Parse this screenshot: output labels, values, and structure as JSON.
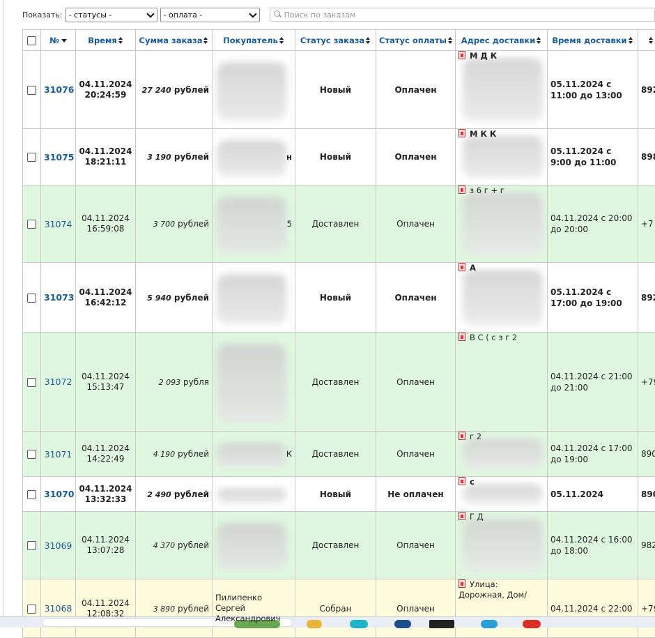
{
  "filters": {
    "show_label": "Показать:",
    "status_select": "- статусы -",
    "payment_select": "- оплата -",
    "search_placeholder": "Поиск по заказам"
  },
  "columns": [
    {
      "key": "num",
      "label": "№",
      "sort": "desc"
    },
    {
      "key": "time",
      "label": "Время",
      "sort": "both"
    },
    {
      "key": "sum",
      "label": "Сумма заказа",
      "sort": "both"
    },
    {
      "key": "buyer",
      "label": "Покупатель",
      "sort": "both"
    },
    {
      "key": "status",
      "label": "Статус заказа",
      "sort": "both"
    },
    {
      "key": "pay",
      "label": "Статус оплаты",
      "sort": "both"
    },
    {
      "key": "addr",
      "label": "Адрес доставки",
      "sort": "both"
    },
    {
      "key": "dtime",
      "label": "Время доставки",
      "sort": "both"
    }
  ],
  "rows": [
    {
      "num": "31076",
      "date": "04.11.2024",
      "time": "20:24:59",
      "amount": "27 240",
      "currency": "рублей",
      "buyer": "",
      "status": "Новый",
      "pay": "Оплачен",
      "addr": "М Д К",
      "dtime": "05.11.2024 с 11:00 до 13:00",
      "phone": "892",
      "state": "new"
    },
    {
      "num": "31075",
      "date": "04.11.2024",
      "time": "18:21:11",
      "amount": "3 190",
      "currency": "рублей",
      "buyer": "н",
      "status": "Новый",
      "pay": "Оплачен",
      "addr": "М К К",
      "dtime": "05.11.2024 с 9:00 до 11:00",
      "phone": "898",
      "state": "new"
    },
    {
      "num": "31074",
      "date": "04.11.2024",
      "time": "16:59:08",
      "amount": "3 700",
      "currency": "рублей",
      "buyer": "5",
      "status": "Доставлен",
      "pay": "Оплачен",
      "addr": "з 6 г + г",
      "dtime": "04.11.2024 с 20:00 до 20:00",
      "phone": "+7",
      "state": "done"
    },
    {
      "num": "31073",
      "date": "04.11.2024",
      "time": "16:42:12",
      "amount": "5 940",
      "currency": "рублей",
      "buyer": "",
      "status": "Новый",
      "pay": "Оплачен",
      "addr": "А",
      "dtime": "05.11.2024 с 17:00 до 19:00",
      "phone": "892",
      "state": "new"
    },
    {
      "num": "31072",
      "date": "04.11.2024",
      "time": "15:13:47",
      "amount": "2 093",
      "currency": "рубля",
      "buyer": "",
      "status": "Доставлен",
      "pay": "Оплачен",
      "addr": "В С ( с з г 2",
      "dtime": "04.11.2024 с 21:00 до 21:00",
      "phone": "+79",
      "state": "done"
    },
    {
      "num": "31071",
      "date": "04.11.2024",
      "time": "14:22:49",
      "amount": "4 190",
      "currency": "рублей",
      "buyer": "К",
      "status": "Доставлен",
      "pay": "Оплачен",
      "addr": "г 2",
      "dtime": "04.11.2024 с 17:00 до 19:00",
      "phone": "890",
      "state": "done"
    },
    {
      "num": "31070",
      "date": "04.11.2024",
      "time": "13:32:33",
      "amount": "2 490",
      "currency": "рублей",
      "buyer": "",
      "status": "Новый",
      "pay": "Не оплачен",
      "addr": "с",
      "dtime": "05.11.2024",
      "phone": "890",
      "state": "new"
    },
    {
      "num": "31069",
      "date": "04.11.2024",
      "time": "13:07:28",
      "amount": "4 370",
      "currency": "рублей",
      "buyer": "",
      "status": "Доставлен",
      "pay": "Оплачен",
      "addr": "Г Д",
      "dtime": "04.11.2024 с 16:00 до 18:00",
      "phone": "982",
      "state": "done"
    },
    {
      "num": "31068",
      "date": "04.11.2024",
      "time": "12:08:32",
      "amount": "3 890",
      "currency": "рублей",
      "buyer": "Пилипенко Сергей Александрович",
      "status": "Собран",
      "pay": "Оплачен",
      "addr": "Улица: Дорожная, Дом/",
      "dtime": "04.11.2024 с 22:00",
      "phone": "+79",
      "state": "built"
    }
  ]
}
